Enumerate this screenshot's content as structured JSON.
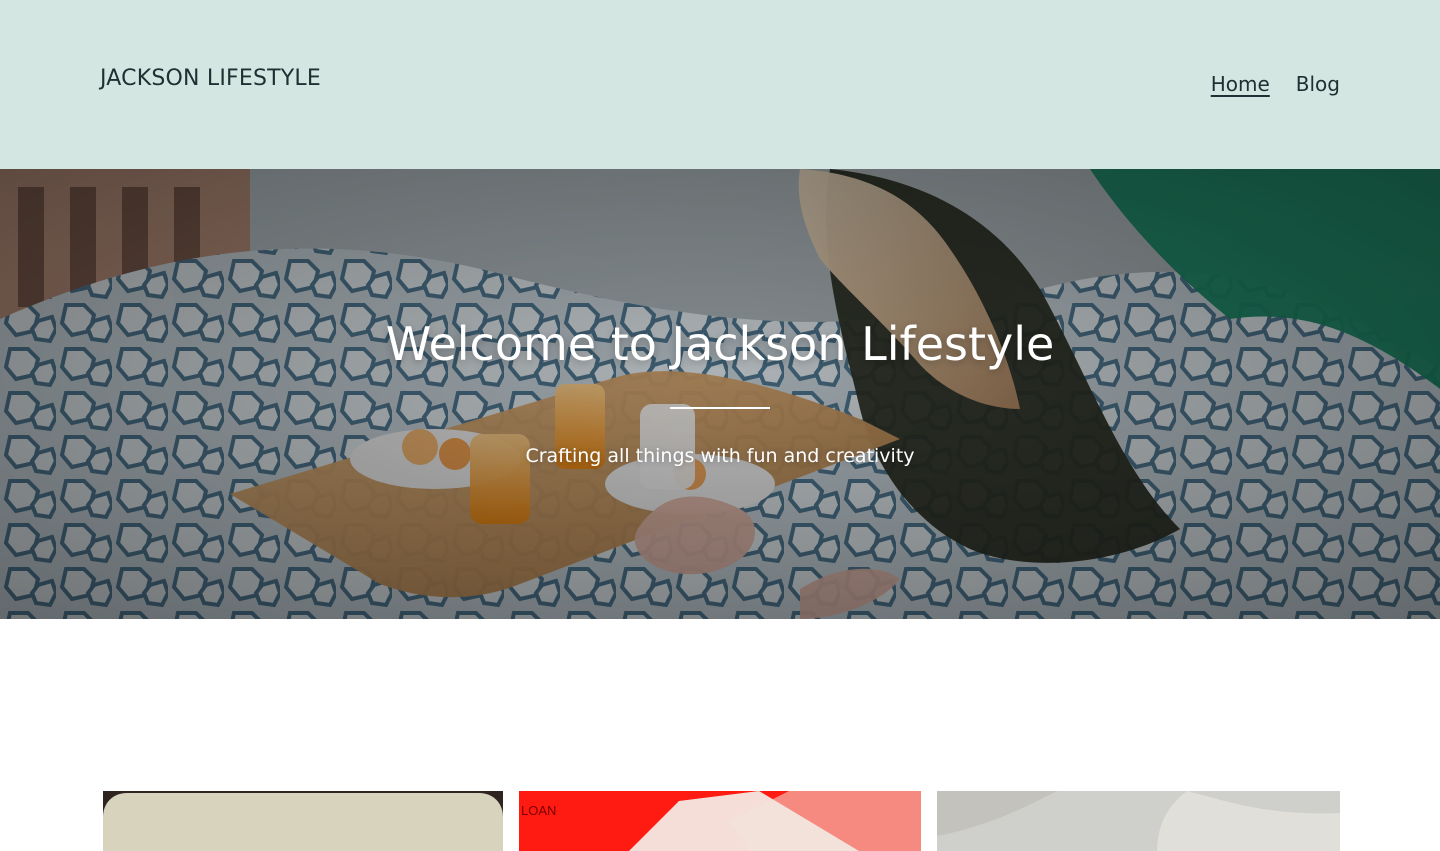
{
  "header": {
    "site_title": "JACKSON LIFESTYLE",
    "nav": [
      {
        "label": "Home",
        "active": true
      },
      {
        "label": "Blog",
        "active": false
      }
    ]
  },
  "hero": {
    "title": "Welcome to Jackson Lifestyle",
    "subtitle": "Crafting all things with fun and creativity"
  },
  "posts": {
    "cards": [
      {
        "image": "beige-rounded-card-image"
      },
      {
        "image": "red-product-image",
        "image_text": "LOAN"
      },
      {
        "image": "soft-gray-image"
      }
    ]
  },
  "colors": {
    "header_bg": "#d4e6e1",
    "text_dark": "#1f2f33",
    "hero_text": "#ffffff"
  }
}
